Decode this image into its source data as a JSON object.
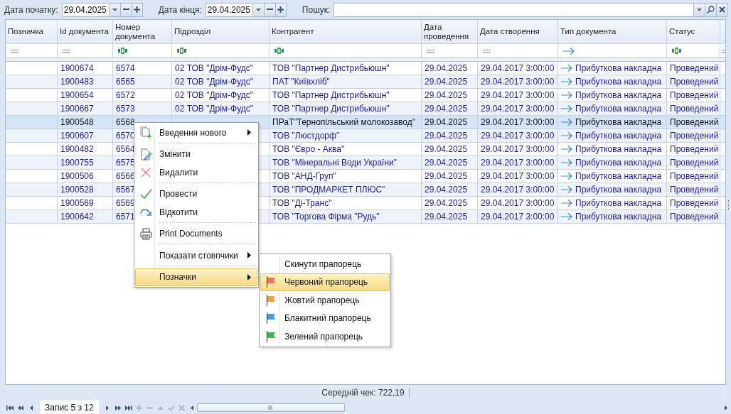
{
  "filters": {
    "start_label": "Дата початку:",
    "start_value": "29.04.2025",
    "end_label": "Дата кінця:",
    "end_value": "29.04.2025",
    "search_label": "Пошук:"
  },
  "table": {
    "columns": [
      {
        "title": "Позначка",
        "kind": "equals"
      },
      {
        "title": "Id документа",
        "kind": "equals"
      },
      {
        "title": "Номер документа",
        "kind": "text"
      },
      {
        "title": "Підрозділ",
        "kind": "text"
      },
      {
        "title": "Контрагент",
        "kind": "text"
      },
      {
        "title": "Дата проведення",
        "kind": "equals"
      },
      {
        "title": "Дата створення",
        "kind": "equals"
      },
      {
        "title": "Тип документа",
        "kind": "arrow"
      },
      {
        "title": "Статус",
        "kind": "text"
      },
      {
        "kind": "equals"
      }
    ],
    "rows": [
      {
        "selected": false,
        "cells": [
          null,
          "1900674",
          "6574",
          "02 ТОВ \"Дрім-Фудс\"",
          "ТОВ \"Партнер Дистрибьюшн\"",
          "29.04.2025",
          "29.04.2017 3:00:00",
          "Прибуткова накладна",
          "Проведений",
          null
        ]
      },
      {
        "selected": false,
        "cells": [
          null,
          "1900483",
          "6565",
          "02 ТОВ \"Дрім-Фудс\"",
          "ПАТ \"Київхліб\"",
          "29.04.2025",
          "29.04.2017 3:00:00",
          "Прибуткова накладна",
          "Проведений",
          null
        ]
      },
      {
        "selected": false,
        "cells": [
          null,
          "1900654",
          "6572",
          "02 ТОВ \"Дрім-Фудс\"",
          "ТОВ \"Партнер Дистрибьюшн\"",
          "29.04.2025",
          "29.04.2017 3:00:00",
          "Прибуткова накладна",
          "Проведений",
          null
        ]
      },
      {
        "selected": false,
        "cells": [
          null,
          "1900667",
          "6573",
          "02 ТОВ \"Дрім-Фудс\"",
          "ТОВ \"Партнер Дистрибьюшн\"",
          "29.04.2025",
          "29.04.2017 3:00:00",
          "Прибуткова накладна",
          "Проведений",
          null
        ]
      },
      {
        "selected": true,
        "cells": [
          null,
          "1900548",
          "6568",
          null,
          "ПРаТ\"Тернопільський молокозавод\"",
          "29.04.2025",
          "29.04.2017 3:00:00",
          "Прибуткова накладна",
          "Проведений",
          null
        ]
      },
      {
        "selected": false,
        "cells": [
          null,
          "1900607",
          "6570",
          null,
          "ТОВ \"Люстдорф\"",
          "29.04.2025",
          "29.04.2017 3:00:00",
          "Прибуткова накладна",
          "Проведений",
          null
        ]
      },
      {
        "selected": false,
        "cells": [
          null,
          "1900482",
          "6564",
          null,
          "ТОВ \"Євро - Аква\"",
          "29.04.2025",
          "29.04.2017 3:00:00",
          "Прибуткова накладна",
          "Проведений",
          null
        ]
      },
      {
        "selected": false,
        "cells": [
          null,
          "1900755",
          "6575",
          null,
          "ТОВ \"Мінеральні Води України\"",
          "29.04.2025",
          "29.04.2017 3:00:00",
          "Прибуткова накладна",
          "Проведений",
          null
        ]
      },
      {
        "selected": false,
        "cells": [
          null,
          "1900506",
          "6566",
          null,
          "ТОВ \"АНД-Груп\"",
          "29.04.2025",
          "29.04.2017 3:00:00",
          "Прибуткова накладна",
          "Проведений",
          null
        ]
      },
      {
        "selected": false,
        "cells": [
          null,
          "1900528",
          "6567",
          null,
          "ТОВ \"ПРОДМАРКЕТ ПЛЮС\"",
          "29.04.2025",
          "29.04.2017 3:00:00",
          "Прибуткова накладна",
          "Проведений",
          null
        ]
      },
      {
        "selected": false,
        "cells": [
          null,
          "1900569",
          "6569",
          null,
          "ТОВ \"Ді-Транс\"",
          "29.04.2025",
          "29.04.2017 3:00:00",
          "Прибуткова накладна",
          "Проведений",
          null
        ]
      },
      {
        "selected": false,
        "cells": [
          null,
          "1900642",
          "6571",
          null,
          "ТОВ \"Торгова Фірма \"Рудь\"",
          "29.04.2025",
          "29.04.2017 3:00:00",
          "Прибуткова накладна",
          "Проведений",
          null
        ]
      }
    ]
  },
  "context_menu": {
    "items": [
      {
        "kind": "item",
        "label": "Введення нового",
        "submenu": true,
        "highlighted": false
      },
      {
        "kind": "separator"
      },
      {
        "kind": "item",
        "label": "Змінити",
        "submenu": false,
        "highlighted": false
      },
      {
        "kind": "item",
        "label": "Видалити",
        "submenu": false,
        "highlighted": false
      },
      {
        "kind": "separator"
      },
      {
        "kind": "item",
        "label": "Провести",
        "submenu": false,
        "highlighted": false
      },
      {
        "kind": "item",
        "label": "Відкотити",
        "submenu": false,
        "highlighted": false
      },
      {
        "kind": "separator"
      },
      {
        "kind": "item",
        "label": "Print Documents",
        "submenu": false,
        "highlighted": false
      },
      {
        "kind": "separator"
      },
      {
        "kind": "item",
        "label": "Показати стовпчики",
        "submenu": true,
        "highlighted": false
      },
      {
        "kind": "separator"
      },
      {
        "kind": "item",
        "label": "Позначки",
        "submenu": true,
        "highlighted": true
      }
    ]
  },
  "flag_menu": {
    "items": [
      {
        "label": "Скинути прапорець",
        "highlighted": false
      },
      {
        "label": "Червоний прапорець",
        "color": "#f07070",
        "highlighted": true
      },
      {
        "label": "Жовтий прапорець",
        "color": "#f5a040",
        "highlighted": false
      },
      {
        "label": "Блакитний прапорець",
        "color": "#4a98e0",
        "highlighted": false
      },
      {
        "label": "Зелений прапорець",
        "color": "#40b060",
        "highlighted": false
      }
    ]
  },
  "status_bar": {
    "summary": "Середній чек: 722,19"
  },
  "navigator": {
    "record": "Запис 5 з 12"
  }
}
